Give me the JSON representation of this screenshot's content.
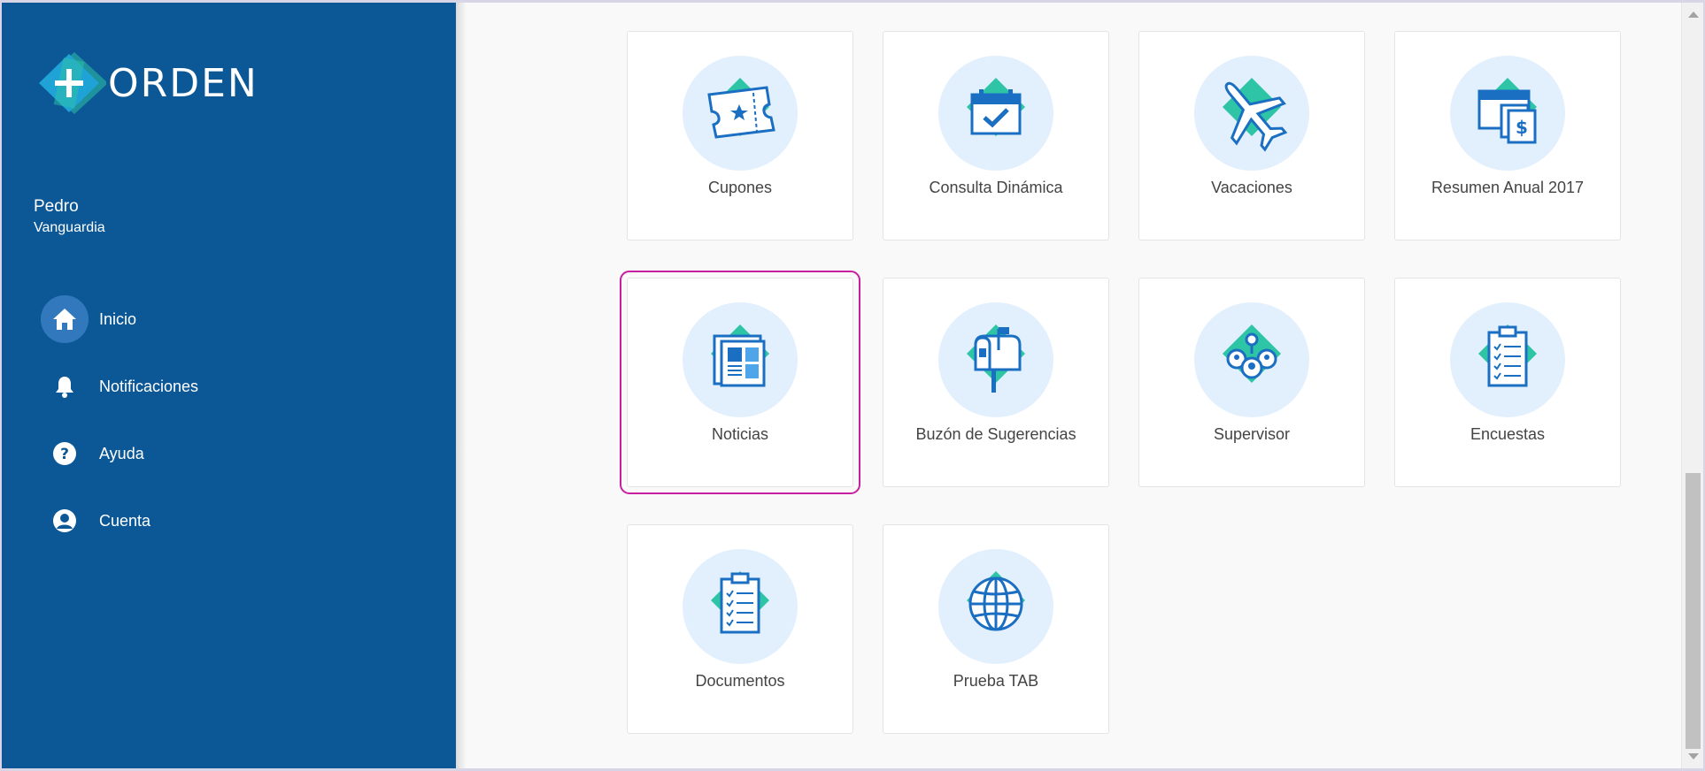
{
  "brand": {
    "name": "ORDEN",
    "colors": {
      "sidebar": "#0c5896",
      "teal": "#2ec4a6",
      "blue": "#1b6fc2",
      "highlight": "#c81ea0"
    }
  },
  "user": {
    "first_name": "Pedro",
    "last_name": "Vanguardia"
  },
  "nav": [
    {
      "label": "Inicio",
      "icon": "home-icon",
      "active": true
    },
    {
      "label": "Notificaciones",
      "icon": "bell-icon",
      "active": false
    },
    {
      "label": "Ayuda",
      "icon": "help-icon",
      "active": false
    },
    {
      "label": "Cuenta",
      "icon": "account-icon",
      "active": false
    }
  ],
  "cards": [
    {
      "label": "Cupones",
      "icon": "ticket-icon"
    },
    {
      "label": "Consulta Dinámica",
      "icon": "calendar-check-icon"
    },
    {
      "label": "Vacaciones",
      "icon": "airplane-icon"
    },
    {
      "label": "Resumen Anual 2017",
      "icon": "annual-summary-icon"
    },
    {
      "label": "Noticias",
      "icon": "newspaper-icon",
      "selected": true
    },
    {
      "label": "Buzón de Sugerencias",
      "icon": "mailbox-icon"
    },
    {
      "label": "Supervisor",
      "icon": "team-icon"
    },
    {
      "label": "Encuestas",
      "icon": "clipboard-icon"
    },
    {
      "label": "Documentos",
      "icon": "documents-icon"
    },
    {
      "label": "Prueba TAB",
      "icon": "globe-icon"
    }
  ]
}
